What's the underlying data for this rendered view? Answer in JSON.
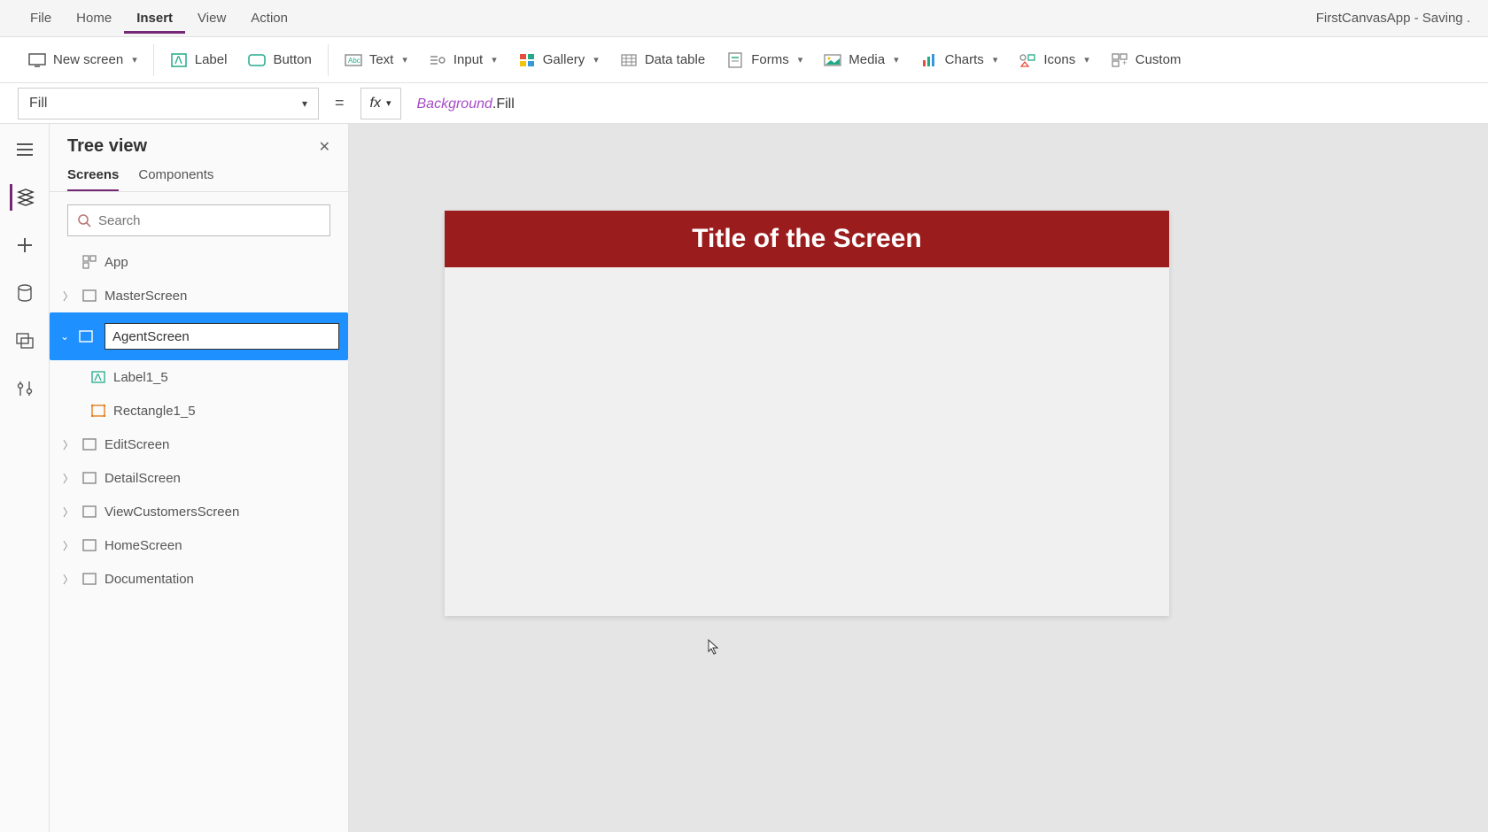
{
  "menu": {
    "items": [
      "File",
      "Home",
      "Insert",
      "View",
      "Action"
    ],
    "activeIndex": 2,
    "appTitle": "FirstCanvasApp - Saving ."
  },
  "ribbon": {
    "newScreen": "New screen",
    "label": "Label",
    "button": "Button",
    "text": "Text",
    "input": "Input",
    "gallery": "Gallery",
    "dataTable": "Data table",
    "forms": "Forms",
    "media": "Media",
    "charts": "Charts",
    "icons": "Icons",
    "custom": "Custom"
  },
  "formula": {
    "property": "Fill",
    "object": "Background",
    "member": ".Fill"
  },
  "treeView": {
    "title": "Tree view",
    "tabs": [
      "Screens",
      "Components"
    ],
    "activeTab": 0,
    "searchPlaceholder": "Search",
    "app": "App",
    "items": [
      {
        "label": "MasterScreen"
      },
      {
        "label": "AgentScreen",
        "editing": true,
        "expanded": true
      },
      {
        "label": "EditScreen"
      },
      {
        "label": "DetailScreen"
      },
      {
        "label": "ViewCustomersScreen"
      },
      {
        "label": "HomeScreen"
      },
      {
        "label": "Documentation"
      }
    ],
    "children": [
      {
        "label": "Label1_5"
      },
      {
        "label": "Rectangle1_5"
      }
    ]
  },
  "canvas": {
    "title": "Title of the Screen"
  }
}
